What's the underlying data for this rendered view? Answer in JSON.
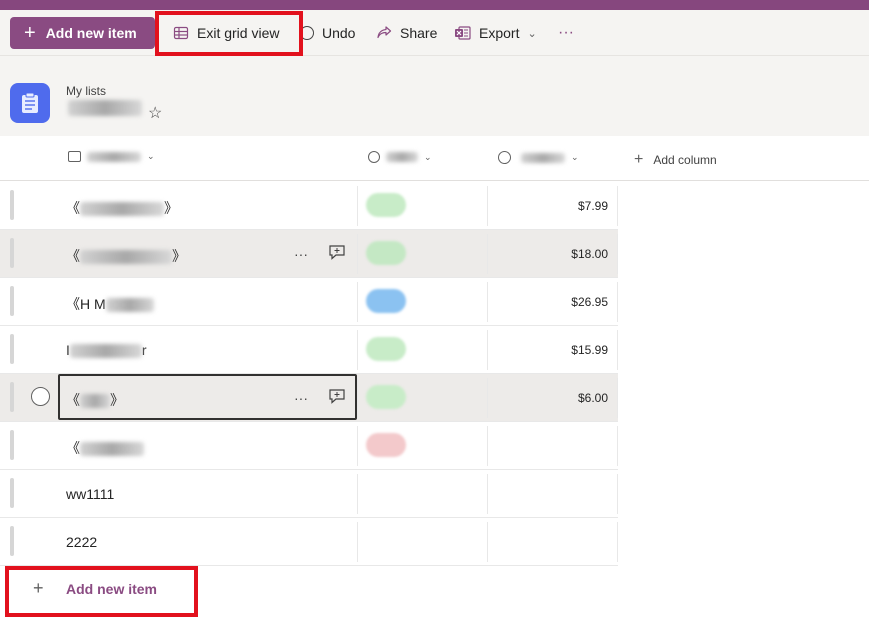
{
  "command_bar": {
    "add_new_item": "Add new item",
    "exit_grid_view": "Exit grid view",
    "undo": "Undo",
    "share": "Share",
    "export": "Export",
    "more": "···"
  },
  "header": {
    "breadcrumb": "My lists",
    "star": "☆"
  },
  "columns": {
    "add_column": "Add column"
  },
  "rows": [
    {
      "title": "《",
      "title_end": "》",
      "price": "$7.99",
      "pill": "#c8ecc8"
    },
    {
      "title": "《",
      "title_end": "》",
      "price": "$18.00",
      "pill": "#c4e8c4"
    },
    {
      "title": "《H M",
      "title_end": "",
      "price": "$26.95",
      "pill": "#8bc2f1"
    },
    {
      "title": "I",
      "title_end": "r",
      "price": "$15.99",
      "pill": "#c8ecc8"
    },
    {
      "title": "《",
      "title_end": "》",
      "price": "$6.00",
      "pill": "#c8ecc8"
    },
    {
      "title": "《",
      "title_end": "",
      "price": "",
      "pill": "#f3c9cb"
    },
    {
      "title": "ww1111",
      "title_end": "",
      "price": "",
      "pill": ""
    },
    {
      "title": "2222",
      "title_end": "",
      "price": "",
      "pill": ""
    }
  ],
  "footer": {
    "add_new_item": "Add new item",
    "plus": "+"
  },
  "colors": {
    "brand": "#8a4b82",
    "highlight_box": "#e2111d",
    "list_icon": "#4f6bed"
  }
}
